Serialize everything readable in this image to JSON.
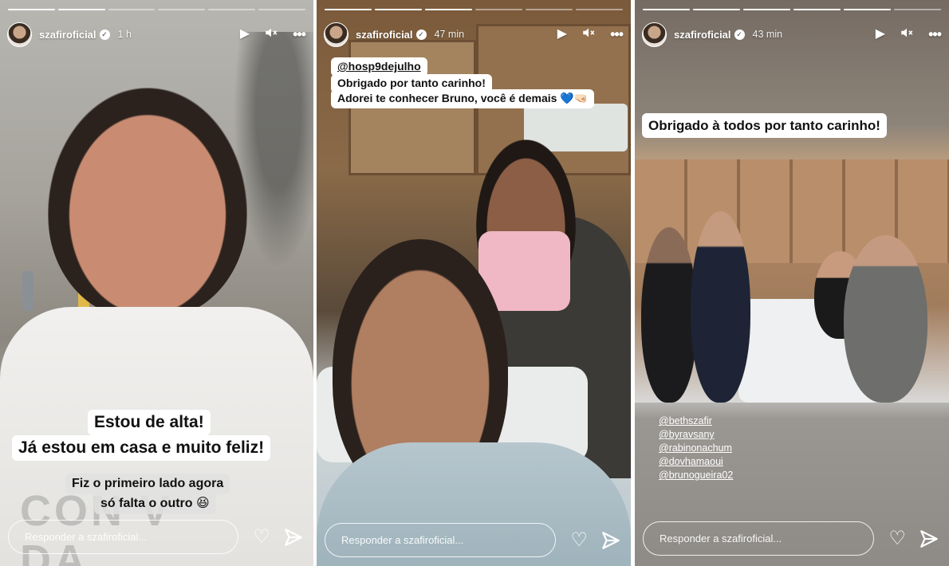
{
  "stories": [
    {
      "username": "szafiroficial",
      "time": "1 h",
      "progress": {
        "segments": 6,
        "completed": 2
      },
      "captions": {
        "line1": "Estou de alta!",
        "line2": "Já estou em casa e muito feliz!",
        "line3": "Fiz o primeiro lado agora",
        "line4": "só falta o outro 😆"
      },
      "reply_placeholder": "Responder a szafiroficial..."
    },
    {
      "username": "szafiroficial",
      "time": "47 min",
      "progress": {
        "segments": 6,
        "completed": 3
      },
      "captions": {
        "mention": "@hosp9dejulho",
        "line1": "Obrigado por tanto carinho!",
        "line2": "Adorei te conhecer Bruno, você é demais 💙🤜🏻"
      },
      "reply_placeholder": "Responder a szafiroficial..."
    },
    {
      "username": "szafiroficial",
      "time": "43 min",
      "progress": {
        "segments": 6,
        "completed": 5
      },
      "captions": {
        "line1": "Obrigado à todos por tanto carinho!"
      },
      "mentions": [
        "@bethszafir",
        "@byravsany",
        "@rabinonachum",
        "@dovhamaoui",
        "@brunogueira02"
      ],
      "reply_placeholder": "Responder a szafiroficial..."
    }
  ],
  "icons": {
    "play": "▶",
    "mute": "🔇",
    "more": "•••",
    "heart": "♡",
    "verified": "✓"
  },
  "colors": {
    "accent_white": "#ffffff",
    "caption_bg": "#ffffff",
    "caption_text": "#111111"
  }
}
